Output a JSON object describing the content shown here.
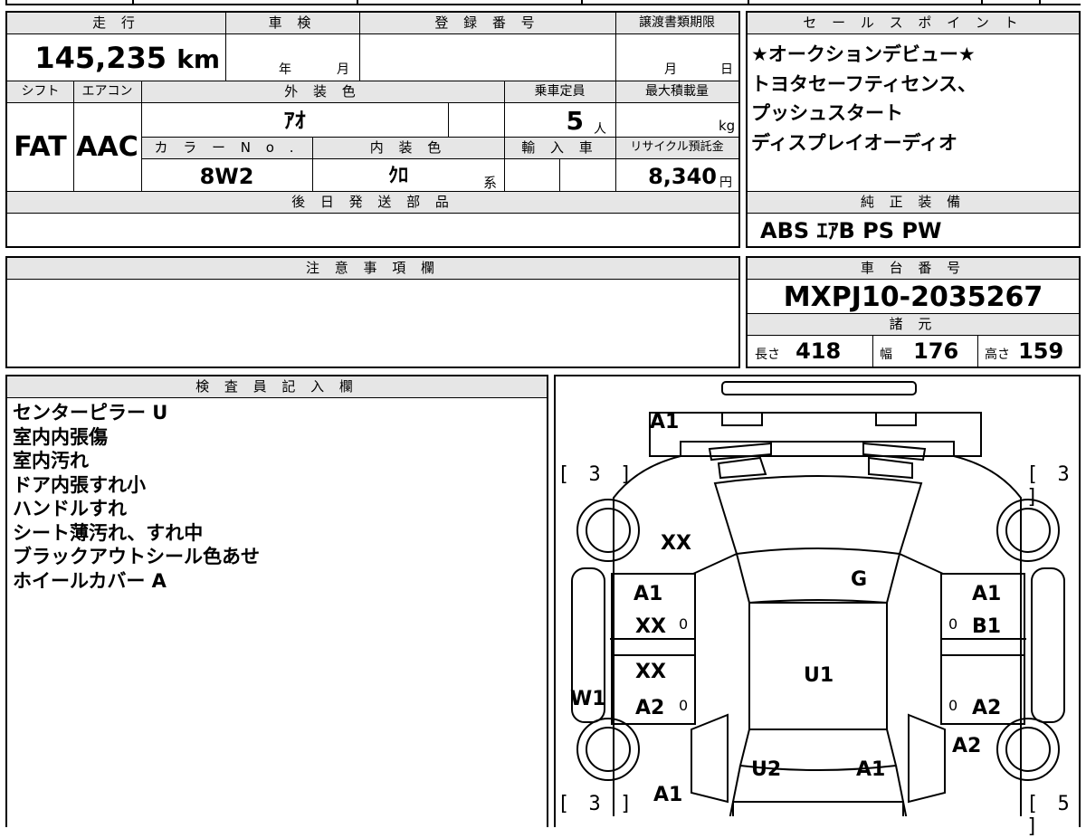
{
  "upper_left": {
    "headers": {
      "mileage": "走 行",
      "inspection": "車 検",
      "registration_number": "登 録 番 号",
      "transfer_deadline": "譲渡書類期限",
      "shift": "シフト",
      "aircon": "エアコン",
      "exterior_color": "外 装 色",
      "capacity": "乗車定員",
      "max_load": "最大積載量",
      "color_no": "カ ラ ー N o .",
      "interior_color": "内 装 色",
      "import": "輸 入 車",
      "recycle_fee": "リサイクル預託金",
      "later_parts": "後 日 発 送 部 品"
    },
    "values": {
      "mileage": "145,235",
      "mileage_unit": "km",
      "inspection_year": "年",
      "inspection_month": "月",
      "transfer_month": "月",
      "transfer_day": "日",
      "shift": "FAT",
      "aircon": "AAC",
      "exterior_color": "ｱｵ",
      "capacity": "5",
      "capacity_unit": "人",
      "max_load_unit": "kg",
      "color_no": "8W2",
      "interior_color": "ｸﾛ",
      "interior_suffix": "系",
      "recycle_fee": "8,340",
      "recycle_unit": "円"
    }
  },
  "sales_points": {
    "header": "セ ー ル ス ポ イ ン ト",
    "lines": [
      "★オークションデビュー★",
      "トヨタセーフティセンス、",
      "プッシュスタート",
      "ディスプレイオーディオ"
    ]
  },
  "equipment": {
    "header": "純 正 装 備",
    "value": "ABS ｴｱB PS PW"
  },
  "caution": {
    "header": "注 意 事 項 欄"
  },
  "chassis": {
    "header": "車 台 番 号",
    "value": "MXPJ10-2035267"
  },
  "specs": {
    "header": "諸 元",
    "length_label": "長さ",
    "length": "418",
    "width_label": "幅",
    "width": "176",
    "height_label": "高さ",
    "height": "159"
  },
  "inspector": {
    "header": "検 査 員 記 入 欄",
    "notes": [
      "センターピラー U",
      "室内内張傷",
      "室内汚れ",
      "ドア内張すれ小",
      "ハンドルすれ",
      "シート薄汚れ、すれ中",
      "ブラックアウトシール色あせ",
      "ホイールカバー A"
    ]
  },
  "diagram": {
    "labels": {
      "front_bumper": "A1",
      "hood": "XX",
      "windshield": "G",
      "front_left_door_1": "A1",
      "front_left_door_2": "XX",
      "front_left_door_0": "0",
      "rear_left_door_1": "XX",
      "rear_left_door_2": "A2",
      "rear_left_door_0": "0",
      "rocker_left": "W1",
      "roof": "U1",
      "front_right_door_1": "A1",
      "front_right_door_2": "B1",
      "front_right_door_0": "0",
      "rear_right_door_0": "0",
      "rear_right_door": "A2",
      "rear_right_fender": "A2",
      "rear_glass_area": "U2",
      "rear_panel": "A1",
      "rear_left_corner": "A1"
    },
    "brackets": {
      "front_left": "[ 3 ]",
      "front_right": "[ 3 ]",
      "rear_left": "[ 3 ]",
      "rear_right": "[ 5 ]"
    }
  }
}
